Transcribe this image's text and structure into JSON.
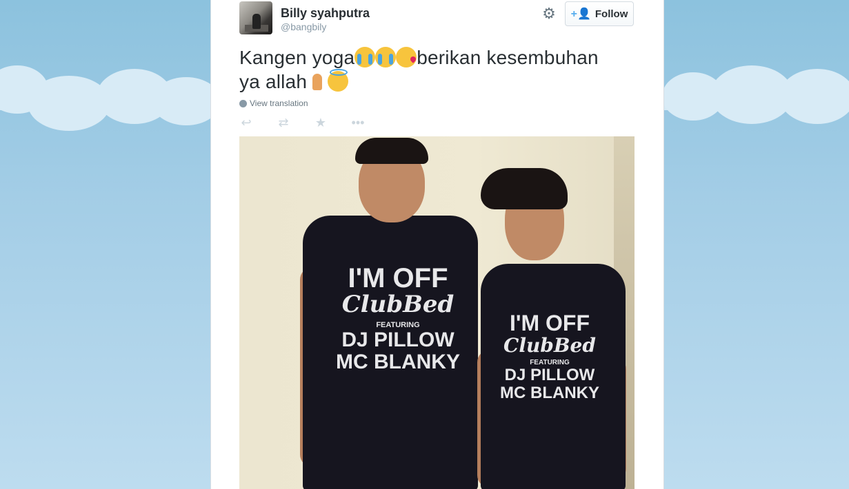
{
  "user": {
    "name": "Billy syahputra",
    "handle": "@bangbily"
  },
  "follow": {
    "label": "Follow"
  },
  "tweet": {
    "line1": "Kangen yoga",
    "line1b": "berikan kesembuhan",
    "line2": "ya allah"
  },
  "translation": {
    "label": "View translation"
  },
  "icons": {
    "settings": "gear-icon",
    "follow": "add-user-icon",
    "reply": "reply-icon",
    "retweet": "retweet-icon",
    "favorite": "star-icon",
    "more": "more-icon",
    "globe": "globe-icon"
  },
  "photo": {
    "shirt_lines": [
      "I'M OFF",
      "ClubBed",
      "FEATURING",
      "DJ PILLOW",
      "MC BLANKY"
    ]
  },
  "colors": {
    "accent": "#55acee",
    "text": "#292f33",
    "muted": "#8899a6"
  }
}
